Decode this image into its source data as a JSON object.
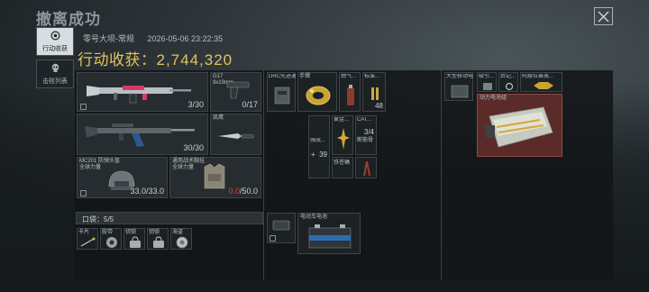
{
  "header": {
    "title": "撤离成功"
  },
  "sidebar": {
    "tabs": [
      {
        "label": "行动收获"
      },
      {
        "label": "击败列表"
      }
    ]
  },
  "summary": {
    "map": "零号大坝-常规",
    "timestamp": "2026-05-06 23:22:35",
    "haul_label": "行动收获：",
    "haul_value": "2,744,320"
  },
  "loadout": {
    "primary": {
      "ammo": "3/30"
    },
    "pistol": {
      "name": "G17",
      "caliber": "9x19mm",
      "ammo": "0/17"
    },
    "secondary": {
      "ammo": "30/30"
    },
    "melee": {
      "name": "凯鹰"
    },
    "helmet": {
      "name": "MC201 防弹头盔",
      "sub": "全球力量",
      "durability": "33.0/33.0"
    },
    "armor": {
      "name": "通用战术胸挂",
      "sub": "全球力量",
      "durability_current": "0.0",
      "durability_max": "/50.0"
    }
  },
  "backpack": {
    "items": [
      {
        "label": "DRC先进通讯三脚..."
      },
      {
        "label": "手镯"
      },
      {
        "label": "燃气..."
      },
      {
        "label": "标准..."
      },
      {
        "label": "强效..."
      },
      {
        "label": "黄金..."
      },
      {
        "label": "CAT..."
      },
      {
        "label": "断筋骨"
      },
      {
        "label": "铁苍蝇"
      }
    ],
    "counts": {
      "standard": "48",
      "strong": "39",
      "cat": "3/4"
    }
  },
  "pouch": {
    "label": "口袋：5/5",
    "items": [
      {
        "label": "卡片"
      },
      {
        "label": "胶带"
      },
      {
        "label": "钥锁"
      },
      {
        "label": "钥锁"
      },
      {
        "label": "海盗"
      }
    ]
  },
  "case": {
    "items": [
      {
        "label": "电动车电池"
      }
    ]
  },
  "safebox": {
    "items": [
      {
        "label": "大型移动电站"
      },
      {
        "label": "吸引..."
      },
      {
        "label": "后记..."
      },
      {
        "label": "阿赫拉赛美..."
      },
      {
        "label": "动力电池组"
      }
    ]
  }
}
